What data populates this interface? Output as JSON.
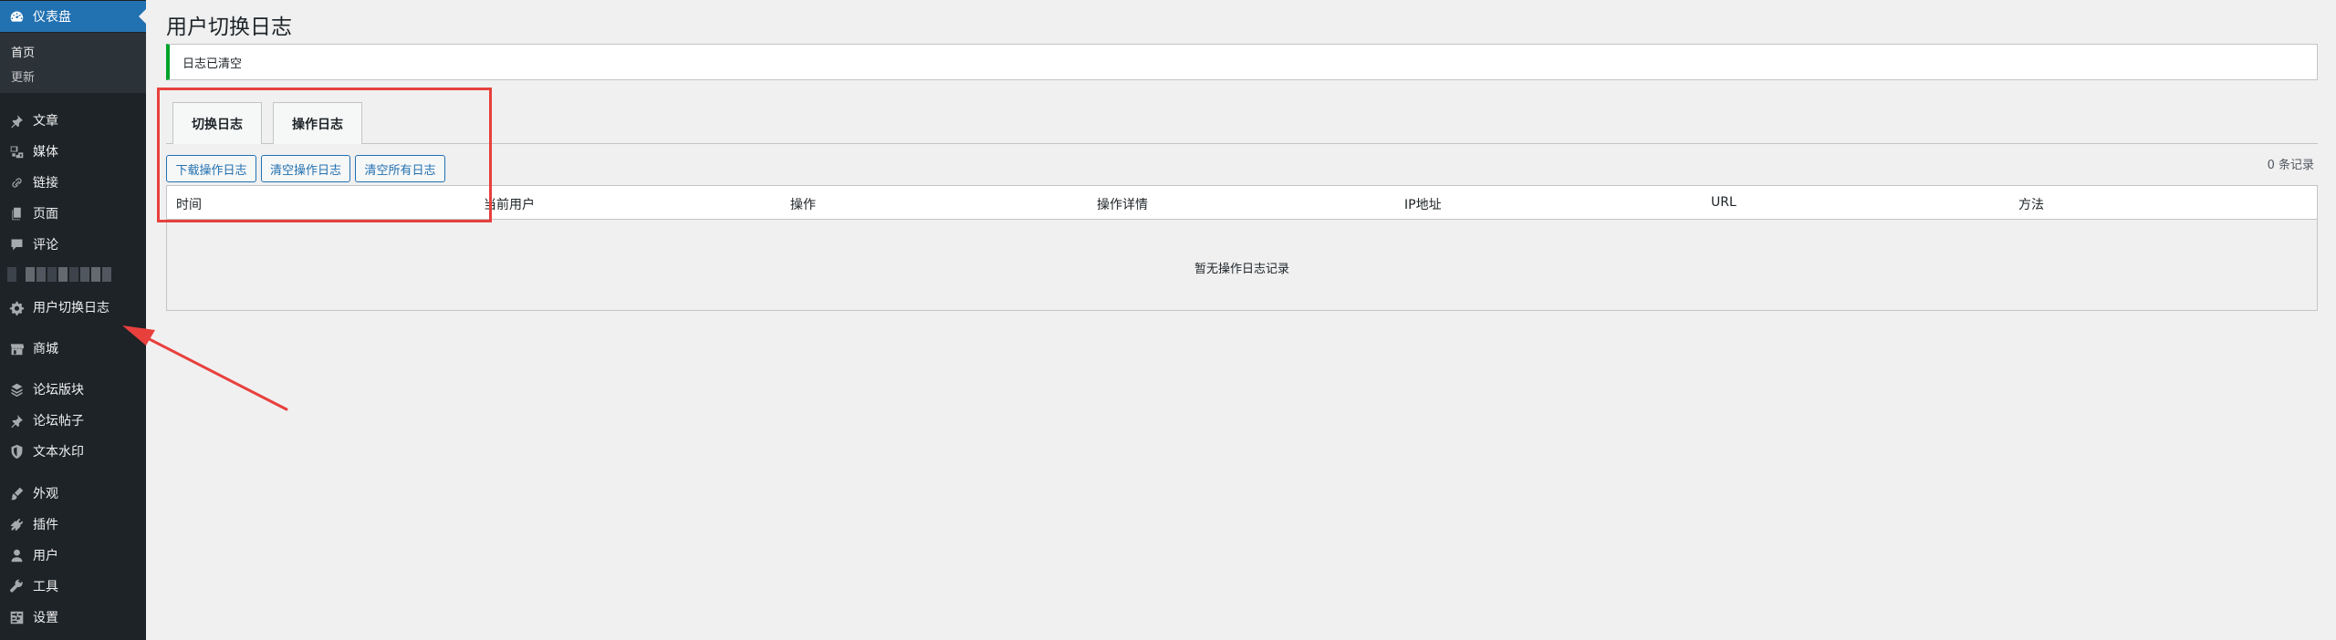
{
  "sidebar": {
    "dashboard": {
      "label": "仪表盘",
      "icon": "dashboard-icon"
    },
    "submenu": [
      {
        "label": "首页"
      },
      {
        "label": "更新"
      }
    ],
    "items": [
      {
        "label": "文章",
        "icon": "pin-icon"
      },
      {
        "label": "媒体",
        "icon": "media-icon"
      },
      {
        "label": "链接",
        "icon": "link-icon"
      },
      {
        "label": "页面",
        "icon": "page-icon"
      },
      {
        "label": "评论",
        "icon": "comment-icon"
      },
      {
        "label": "用户切换日志",
        "icon": "gear-icon"
      },
      {
        "label": "商城",
        "icon": "store-icon"
      },
      {
        "label": "论坛版块",
        "icon": "forum-icon"
      },
      {
        "label": "论坛帖子",
        "icon": "post-icon"
      },
      {
        "label": "文本水印",
        "icon": "shield-icon"
      },
      {
        "label": "外观",
        "icon": "brush-icon"
      },
      {
        "label": "插件",
        "icon": "plugin-icon"
      },
      {
        "label": "用户",
        "icon": "user-icon"
      },
      {
        "label": "工具",
        "icon": "wrench-icon"
      },
      {
        "label": "设置",
        "icon": "settings-icon"
      }
    ]
  },
  "page": {
    "title": "用户切换日志",
    "notice": "日志已清空",
    "tabs": [
      {
        "label": "切换日志"
      },
      {
        "label": "操作日志"
      }
    ],
    "buttons": {
      "download": "下载操作日志",
      "clear_ops": "清空操作日志",
      "clear_all": "清空所有日志"
    },
    "record_count": "0 条记录",
    "table": {
      "columns": [
        "时间",
        "当前用户",
        "操作",
        "操作详情",
        "IP地址",
        "URL",
        "方法"
      ],
      "empty_message": "暂无操作日志记录"
    }
  },
  "colors": {
    "sidebar_bg": "#1d2327",
    "accent": "#2271b1",
    "notice_success": "#00a32a",
    "annotation": "#e8403d"
  }
}
